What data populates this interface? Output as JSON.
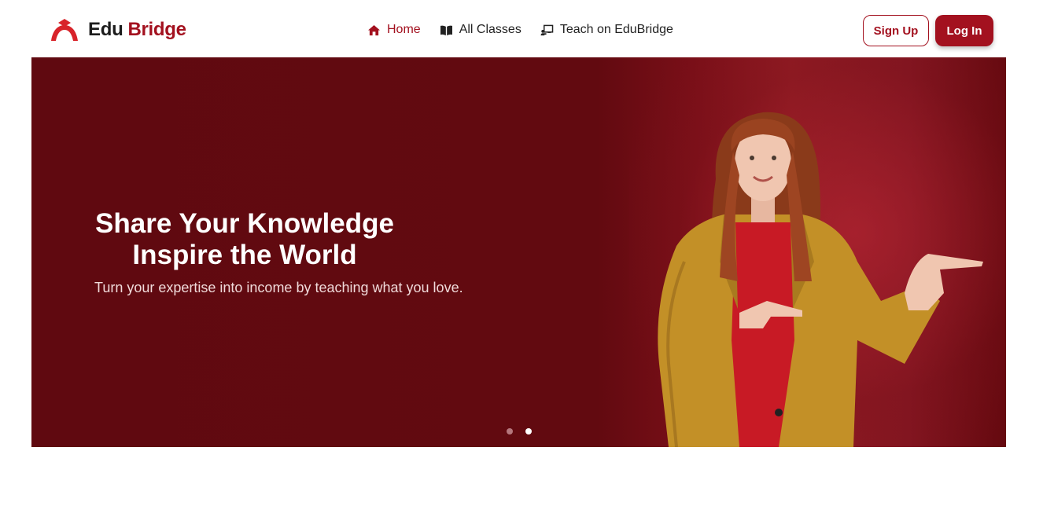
{
  "brand": {
    "name_part1": "Edu",
    "name_part2": "Bridge"
  },
  "nav": {
    "links": [
      {
        "label": "Home",
        "icon": "home-icon",
        "active": true
      },
      {
        "label": "All Classes",
        "icon": "book-open-icon",
        "active": false
      },
      {
        "label": "Teach on EduBridge",
        "icon": "chalkboard-teacher-icon",
        "active": false
      }
    ]
  },
  "auth": {
    "signup_label": "Sign Up",
    "login_label": "Log In"
  },
  "hero": {
    "title_line1": "Share Your Knowledge",
    "title_line2": "Inspire the World",
    "subtitle": "Turn your expertise into income by teaching what you love.",
    "slides_count": 2,
    "active_slide": 2
  },
  "colors": {
    "brand": "#a3111f",
    "hero_bg": "#600910",
    "coat": "#c9952a",
    "sweater": "#c81a25"
  }
}
